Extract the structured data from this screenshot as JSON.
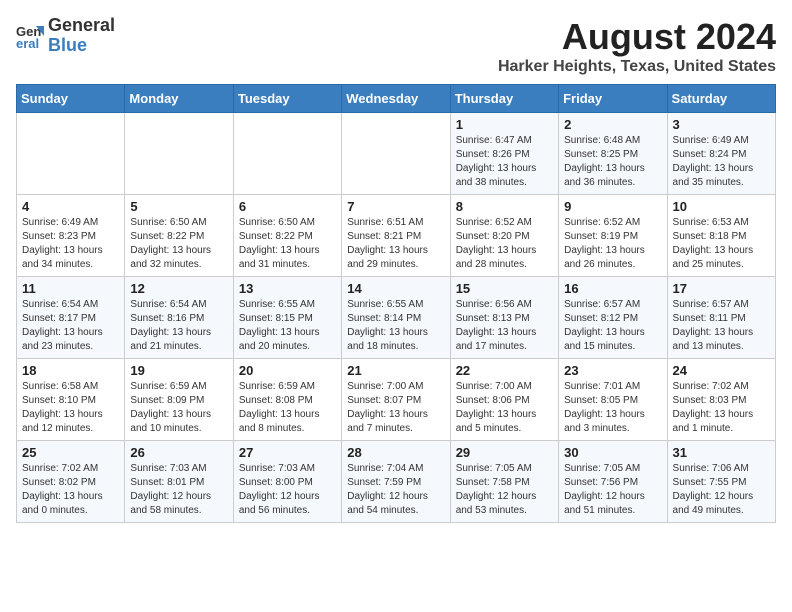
{
  "header": {
    "logo_line1": "General",
    "logo_line2": "Blue",
    "main_title": "August 2024",
    "subtitle": "Harker Heights, Texas, United States"
  },
  "weekdays": [
    "Sunday",
    "Monday",
    "Tuesday",
    "Wednesday",
    "Thursday",
    "Friday",
    "Saturday"
  ],
  "weeks": [
    [
      {
        "day": "",
        "info": ""
      },
      {
        "day": "",
        "info": ""
      },
      {
        "day": "",
        "info": ""
      },
      {
        "day": "",
        "info": ""
      },
      {
        "day": "1",
        "info": "Sunrise: 6:47 AM\nSunset: 8:26 PM\nDaylight: 13 hours\nand 38 minutes."
      },
      {
        "day": "2",
        "info": "Sunrise: 6:48 AM\nSunset: 8:25 PM\nDaylight: 13 hours\nand 36 minutes."
      },
      {
        "day": "3",
        "info": "Sunrise: 6:49 AM\nSunset: 8:24 PM\nDaylight: 13 hours\nand 35 minutes."
      }
    ],
    [
      {
        "day": "4",
        "info": "Sunrise: 6:49 AM\nSunset: 8:23 PM\nDaylight: 13 hours\nand 34 minutes."
      },
      {
        "day": "5",
        "info": "Sunrise: 6:50 AM\nSunset: 8:22 PM\nDaylight: 13 hours\nand 32 minutes."
      },
      {
        "day": "6",
        "info": "Sunrise: 6:50 AM\nSunset: 8:22 PM\nDaylight: 13 hours\nand 31 minutes."
      },
      {
        "day": "7",
        "info": "Sunrise: 6:51 AM\nSunset: 8:21 PM\nDaylight: 13 hours\nand 29 minutes."
      },
      {
        "day": "8",
        "info": "Sunrise: 6:52 AM\nSunset: 8:20 PM\nDaylight: 13 hours\nand 28 minutes."
      },
      {
        "day": "9",
        "info": "Sunrise: 6:52 AM\nSunset: 8:19 PM\nDaylight: 13 hours\nand 26 minutes."
      },
      {
        "day": "10",
        "info": "Sunrise: 6:53 AM\nSunset: 8:18 PM\nDaylight: 13 hours\nand 25 minutes."
      }
    ],
    [
      {
        "day": "11",
        "info": "Sunrise: 6:54 AM\nSunset: 8:17 PM\nDaylight: 13 hours\nand 23 minutes."
      },
      {
        "day": "12",
        "info": "Sunrise: 6:54 AM\nSunset: 8:16 PM\nDaylight: 13 hours\nand 21 minutes."
      },
      {
        "day": "13",
        "info": "Sunrise: 6:55 AM\nSunset: 8:15 PM\nDaylight: 13 hours\nand 20 minutes."
      },
      {
        "day": "14",
        "info": "Sunrise: 6:55 AM\nSunset: 8:14 PM\nDaylight: 13 hours\nand 18 minutes."
      },
      {
        "day": "15",
        "info": "Sunrise: 6:56 AM\nSunset: 8:13 PM\nDaylight: 13 hours\nand 17 minutes."
      },
      {
        "day": "16",
        "info": "Sunrise: 6:57 AM\nSunset: 8:12 PM\nDaylight: 13 hours\nand 15 minutes."
      },
      {
        "day": "17",
        "info": "Sunrise: 6:57 AM\nSunset: 8:11 PM\nDaylight: 13 hours\nand 13 minutes."
      }
    ],
    [
      {
        "day": "18",
        "info": "Sunrise: 6:58 AM\nSunset: 8:10 PM\nDaylight: 13 hours\nand 12 minutes."
      },
      {
        "day": "19",
        "info": "Sunrise: 6:59 AM\nSunset: 8:09 PM\nDaylight: 13 hours\nand 10 minutes."
      },
      {
        "day": "20",
        "info": "Sunrise: 6:59 AM\nSunset: 8:08 PM\nDaylight: 13 hours\nand 8 minutes."
      },
      {
        "day": "21",
        "info": "Sunrise: 7:00 AM\nSunset: 8:07 PM\nDaylight: 13 hours\nand 7 minutes."
      },
      {
        "day": "22",
        "info": "Sunrise: 7:00 AM\nSunset: 8:06 PM\nDaylight: 13 hours\nand 5 minutes."
      },
      {
        "day": "23",
        "info": "Sunrise: 7:01 AM\nSunset: 8:05 PM\nDaylight: 13 hours\nand 3 minutes."
      },
      {
        "day": "24",
        "info": "Sunrise: 7:02 AM\nSunset: 8:03 PM\nDaylight: 13 hours\nand 1 minute."
      }
    ],
    [
      {
        "day": "25",
        "info": "Sunrise: 7:02 AM\nSunset: 8:02 PM\nDaylight: 13 hours\nand 0 minutes."
      },
      {
        "day": "26",
        "info": "Sunrise: 7:03 AM\nSunset: 8:01 PM\nDaylight: 12 hours\nand 58 minutes."
      },
      {
        "day": "27",
        "info": "Sunrise: 7:03 AM\nSunset: 8:00 PM\nDaylight: 12 hours\nand 56 minutes."
      },
      {
        "day": "28",
        "info": "Sunrise: 7:04 AM\nSunset: 7:59 PM\nDaylight: 12 hours\nand 54 minutes."
      },
      {
        "day": "29",
        "info": "Sunrise: 7:05 AM\nSunset: 7:58 PM\nDaylight: 12 hours\nand 53 minutes."
      },
      {
        "day": "30",
        "info": "Sunrise: 7:05 AM\nSunset: 7:56 PM\nDaylight: 12 hours\nand 51 minutes."
      },
      {
        "day": "31",
        "info": "Sunrise: 7:06 AM\nSunset: 7:55 PM\nDaylight: 12 hours\nand 49 minutes."
      }
    ]
  ]
}
